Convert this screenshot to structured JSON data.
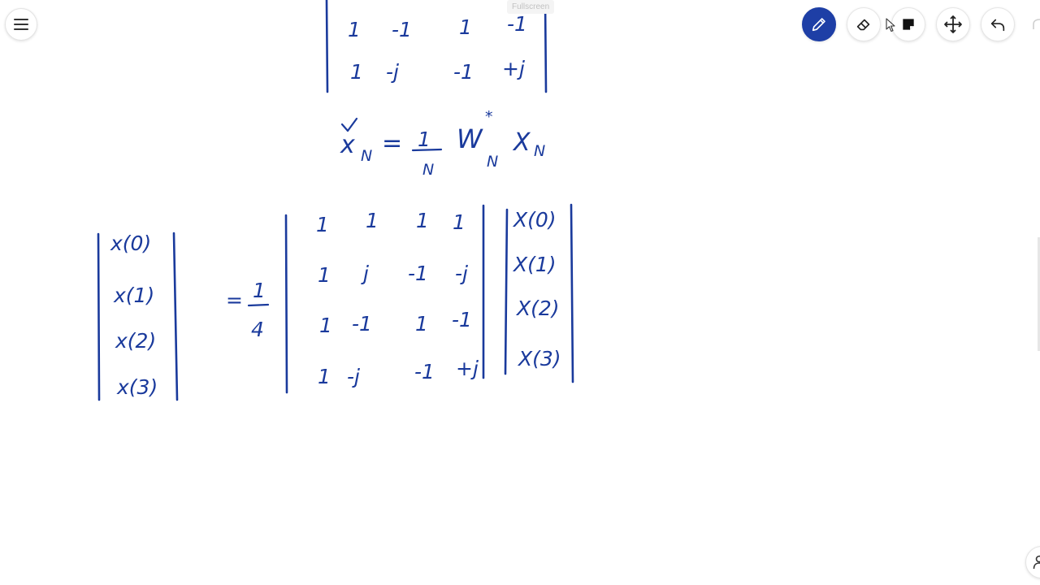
{
  "app": {
    "tooltip": "Fullscreen",
    "ink_color": "#1a3a9c",
    "accent_color": "#1e3fa6"
  },
  "toolbar": {
    "menu_icon": "hamburger-menu-icon",
    "tools": [
      {
        "name": "pen",
        "icon": "pen-icon",
        "active": true
      },
      {
        "name": "eraser",
        "icon": "eraser-icon",
        "active": false
      },
      {
        "name": "sticky-note",
        "icon": "sticky-note-icon",
        "active": false
      },
      {
        "name": "move",
        "icon": "move-arrows-icon",
        "active": false
      },
      {
        "name": "undo",
        "icon": "undo-icon",
        "active": false
      }
    ]
  },
  "board": {
    "top_matrix_rows": [
      [
        "1",
        "-1",
        "1",
        "-1"
      ],
      [
        "1",
        "-j",
        "-1",
        "+j"
      ]
    ],
    "formula": {
      "lhs": "x",
      "lhs_sub": "N",
      "equals": "=",
      "frac_num": "1",
      "frac_den": "N",
      "w": "W",
      "w_sup": "*",
      "w_sub": "N",
      "rhs": "X",
      "rhs_sub": "N"
    },
    "lhs_vector": [
      "x(0)",
      "x(1)",
      "x(2)",
      "x(3)"
    ],
    "scalar": {
      "equals": "=",
      "num": "1",
      "den": "4"
    },
    "matrix_rows": [
      [
        "1",
        "1",
        "1",
        "1"
      ],
      [
        "1",
        "j",
        "-1",
        "-j"
      ],
      [
        "1",
        "-1",
        "1",
        "-1"
      ],
      [
        "1",
        "-j",
        "-1",
        "+j"
      ]
    ],
    "rhs_vector": [
      "X(0)",
      "X(1)",
      "X(2)",
      "X(3)"
    ]
  }
}
